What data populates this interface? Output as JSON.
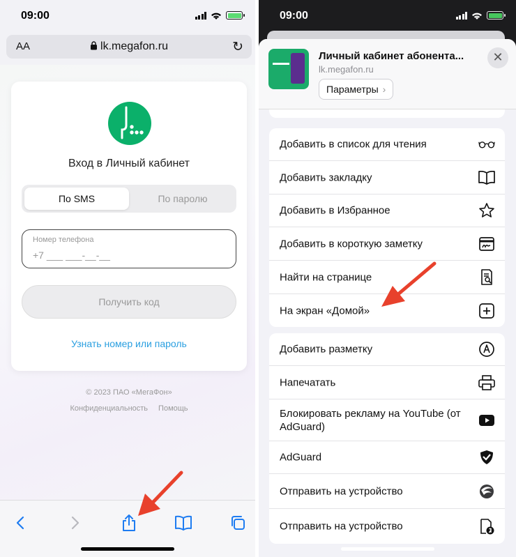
{
  "left": {
    "status": {
      "time": "09:00"
    },
    "address_bar": {
      "text_size_label": "AA",
      "url": "lk.megafon.ru"
    },
    "login": {
      "title": "Вход в Личный кабинет",
      "tabs": [
        {
          "label": "По SMS",
          "active": true
        },
        {
          "label": "По паролю",
          "active": false
        }
      ],
      "phone_label": "Номер телефона",
      "phone_value": "+7 ___ ___-__-__",
      "submit_label": "Получить код",
      "forgot_link": "Узнать номер или пароль"
    },
    "footer": {
      "copyright": "© 2023 ПАО «МегаФон»",
      "links": [
        "Конфиденциальность",
        "Помощь"
      ]
    },
    "toolbar": {
      "icons": [
        "back-icon",
        "forward-icon",
        "share-icon",
        "bookmarks-icon",
        "tabs-icon"
      ]
    }
  },
  "right": {
    "status": {
      "time": "09:00"
    },
    "share_sheet": {
      "title": "Личный кабинет абонента...",
      "url": "lk.megafon.ru",
      "params_label": "Параметры",
      "close_glyph": "✕"
    },
    "groups": [
      [
        {
          "label": "Добавить в список для чтения",
          "icon": "glasses-icon"
        },
        {
          "label": "Добавить закладку",
          "icon": "book-icon"
        },
        {
          "label": "Добавить в Избранное",
          "icon": "star-icon"
        },
        {
          "label": "Добавить в короткую заметку",
          "icon": "quick-note-icon"
        },
        {
          "label": "Найти на странице",
          "icon": "find-in-page-icon"
        },
        {
          "label": "На экран «Домой»",
          "icon": "add-square-icon"
        }
      ],
      [
        {
          "label": "Добавить разметку",
          "icon": "markup-icon"
        },
        {
          "label": "Напечатать",
          "icon": "printer-icon"
        },
        {
          "label": "Блокировать рекламу на YouTube (от AdGuard)",
          "icon": "youtube-icon"
        },
        {
          "label": "AdGuard",
          "icon": "adguard-shield-icon"
        },
        {
          "label": "Отправить на устройство",
          "icon": "send-device-icon"
        },
        {
          "label": "Отправить на устройство",
          "icon": "yandex-send-icon"
        }
      ]
    ]
  },
  "colors": {
    "megafon_green": "#0bb06a",
    "ios_blue": "#1e7cf1",
    "arrow_red": "#e8412c",
    "link_blue": "#2a9fe0"
  }
}
